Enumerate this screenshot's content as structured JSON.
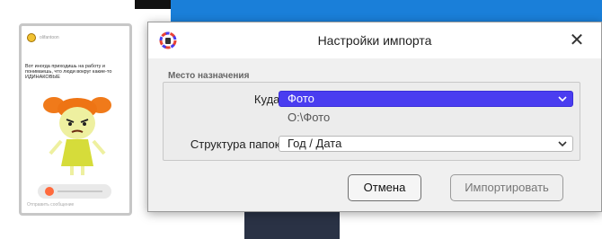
{
  "story": {
    "username": "olifantoon",
    "text": "Вот иногда приходишь на работу и понимаешь, что люди вокруг какие-то ИДИНАКОВЫЕ",
    "footer": "Отправить сообщение"
  },
  "dialog": {
    "title": "Настройки импорта",
    "group_label": "Место назначения",
    "destination_label": "Куда:",
    "destination_value": "Фото",
    "destination_path": "O:\\Фото",
    "folder_structure_label": "Структура папок:",
    "folder_structure_value": "Год / Дата",
    "cancel_label": "Отмена",
    "import_label": "Импортировать"
  },
  "colors": {
    "accent": "#4a3df0",
    "page_blue": "#1a7fd9"
  },
  "icons": {
    "app": "photos-app-icon",
    "close": "close-icon",
    "dropdown": "chevron-down-icon"
  }
}
